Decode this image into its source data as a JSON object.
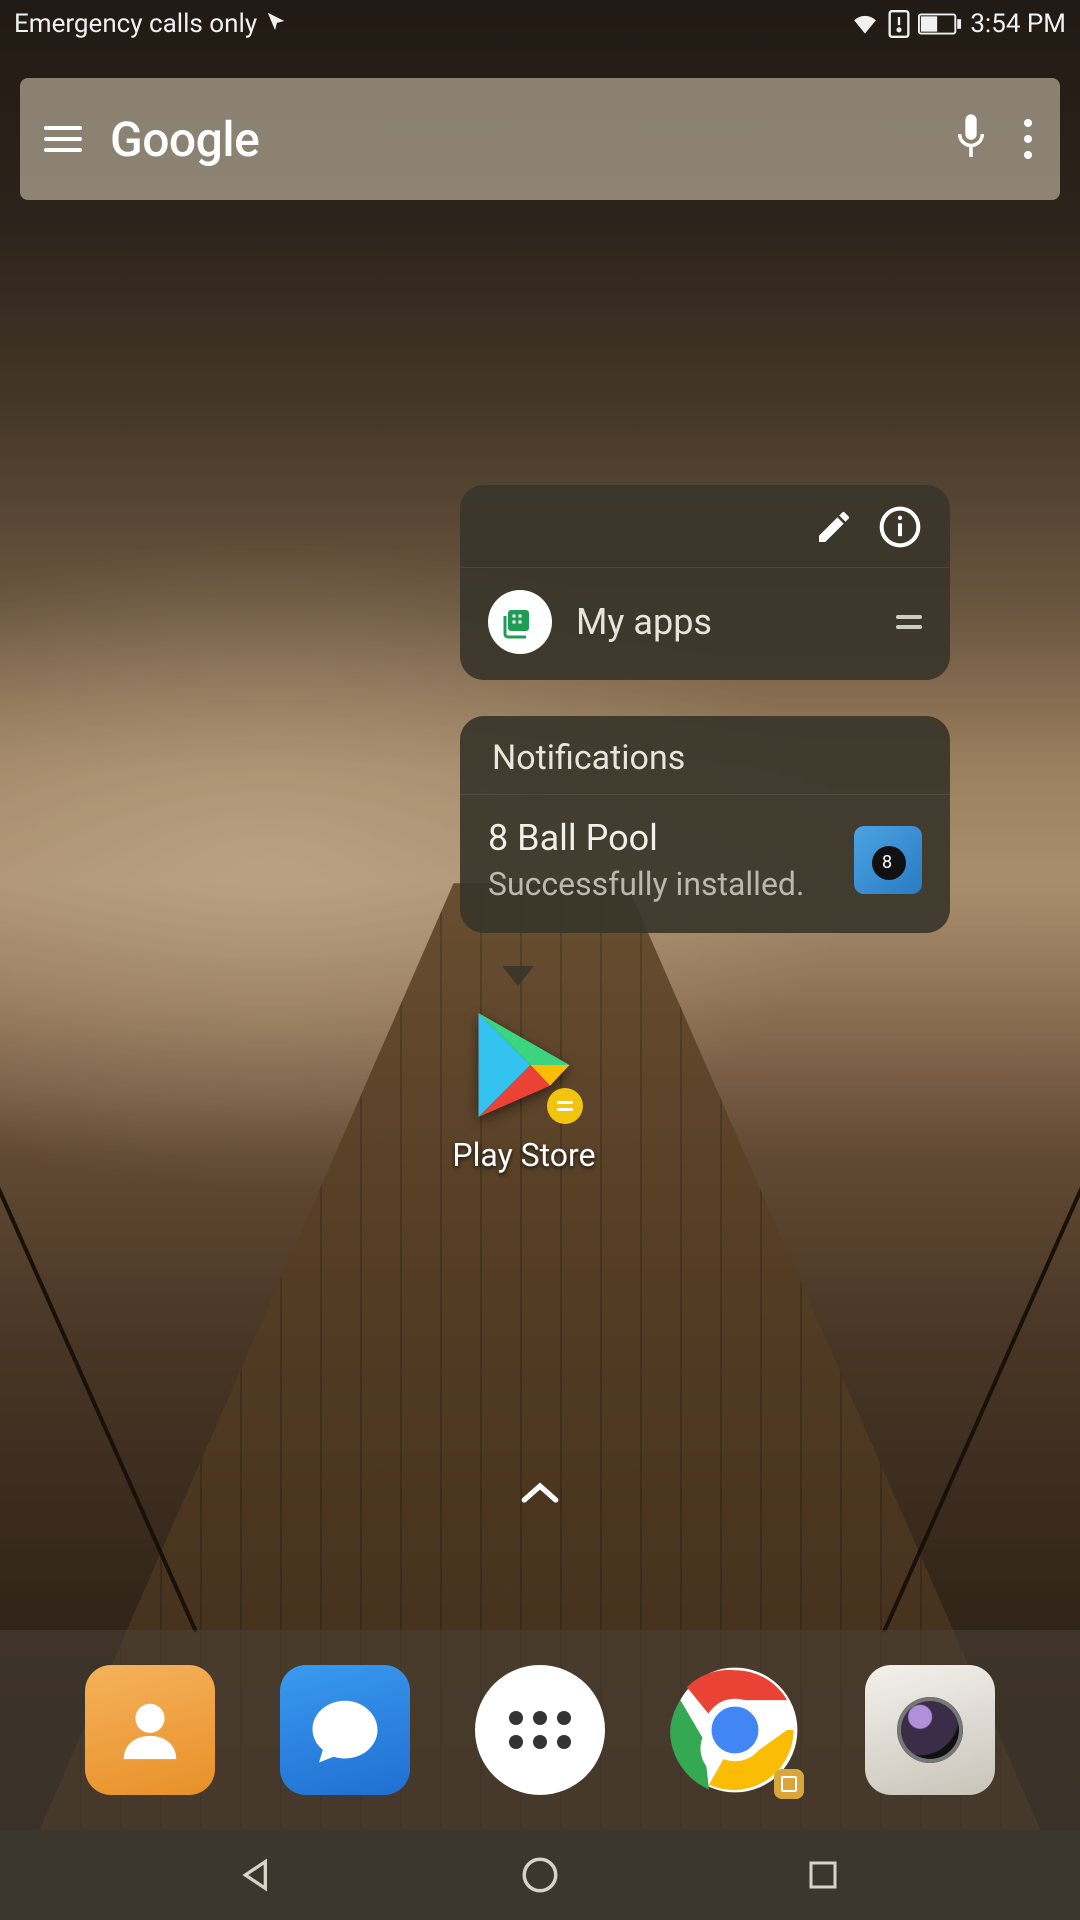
{
  "status_bar": {
    "network_text": "Emergency calls only",
    "time": "3:54 PM"
  },
  "search_widget": {
    "logo_text": "Google"
  },
  "popup": {
    "myapps_label": "My apps",
    "notifications_header": "Notifications",
    "notification": {
      "title": "8 Ball Pool",
      "subtitle": "Successfully installed."
    }
  },
  "home_icon": {
    "label": "Play Store"
  }
}
